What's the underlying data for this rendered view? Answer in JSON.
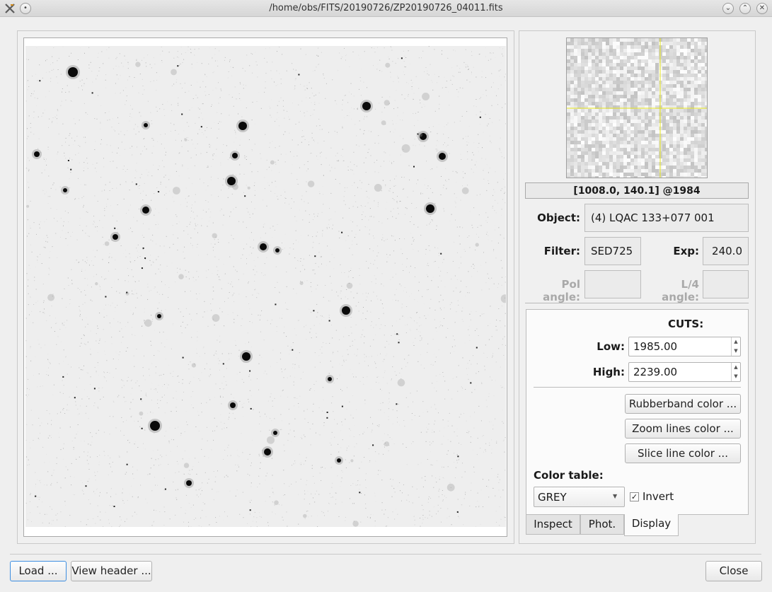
{
  "window": {
    "title": "/home/obs/FITS/20190726/ZP20190726_04011.fits",
    "minimize_glyph": "⌄",
    "maximize_glyph": "⌃",
    "close_glyph": "✕"
  },
  "zoom": {
    "coords_text": "[1008.0,  140.1] @1984"
  },
  "info": {
    "object_label": "Object:",
    "object_value": "(4) LQAC 133+077 001",
    "filter_label": "Filter:",
    "filter_value": "SED725",
    "exp_label": "Exp:",
    "exp_value": "240.0",
    "pol_angle_label": "Pol angle:",
    "pol_angle_value": "",
    "l4_angle_label": "L/4 angle:",
    "l4_angle_value": ""
  },
  "display": {
    "cuts_title": "CUTS:",
    "low_label": "Low:",
    "low_value": "1985.00",
    "high_label": "High:",
    "high_value": "2239.00",
    "rubberband_button": "Rubberband color ...",
    "zoom_lines_button": "Zoom lines color ...",
    "slice_line_button": "Slice line color ...",
    "color_table_label": "Color table:",
    "color_table_value": "GREY",
    "invert_label": "Invert",
    "invert_checked": true
  },
  "tabs": {
    "inspect": "Inspect",
    "phot": "Phot.",
    "display": "Display",
    "active": "display"
  },
  "buttons": {
    "load": "Load ...",
    "view_header": "View header ...",
    "close": "Close"
  },
  "colors": {
    "zoom_crosshair": "#e8e81a",
    "accent_focus": "#3d8ee0"
  }
}
